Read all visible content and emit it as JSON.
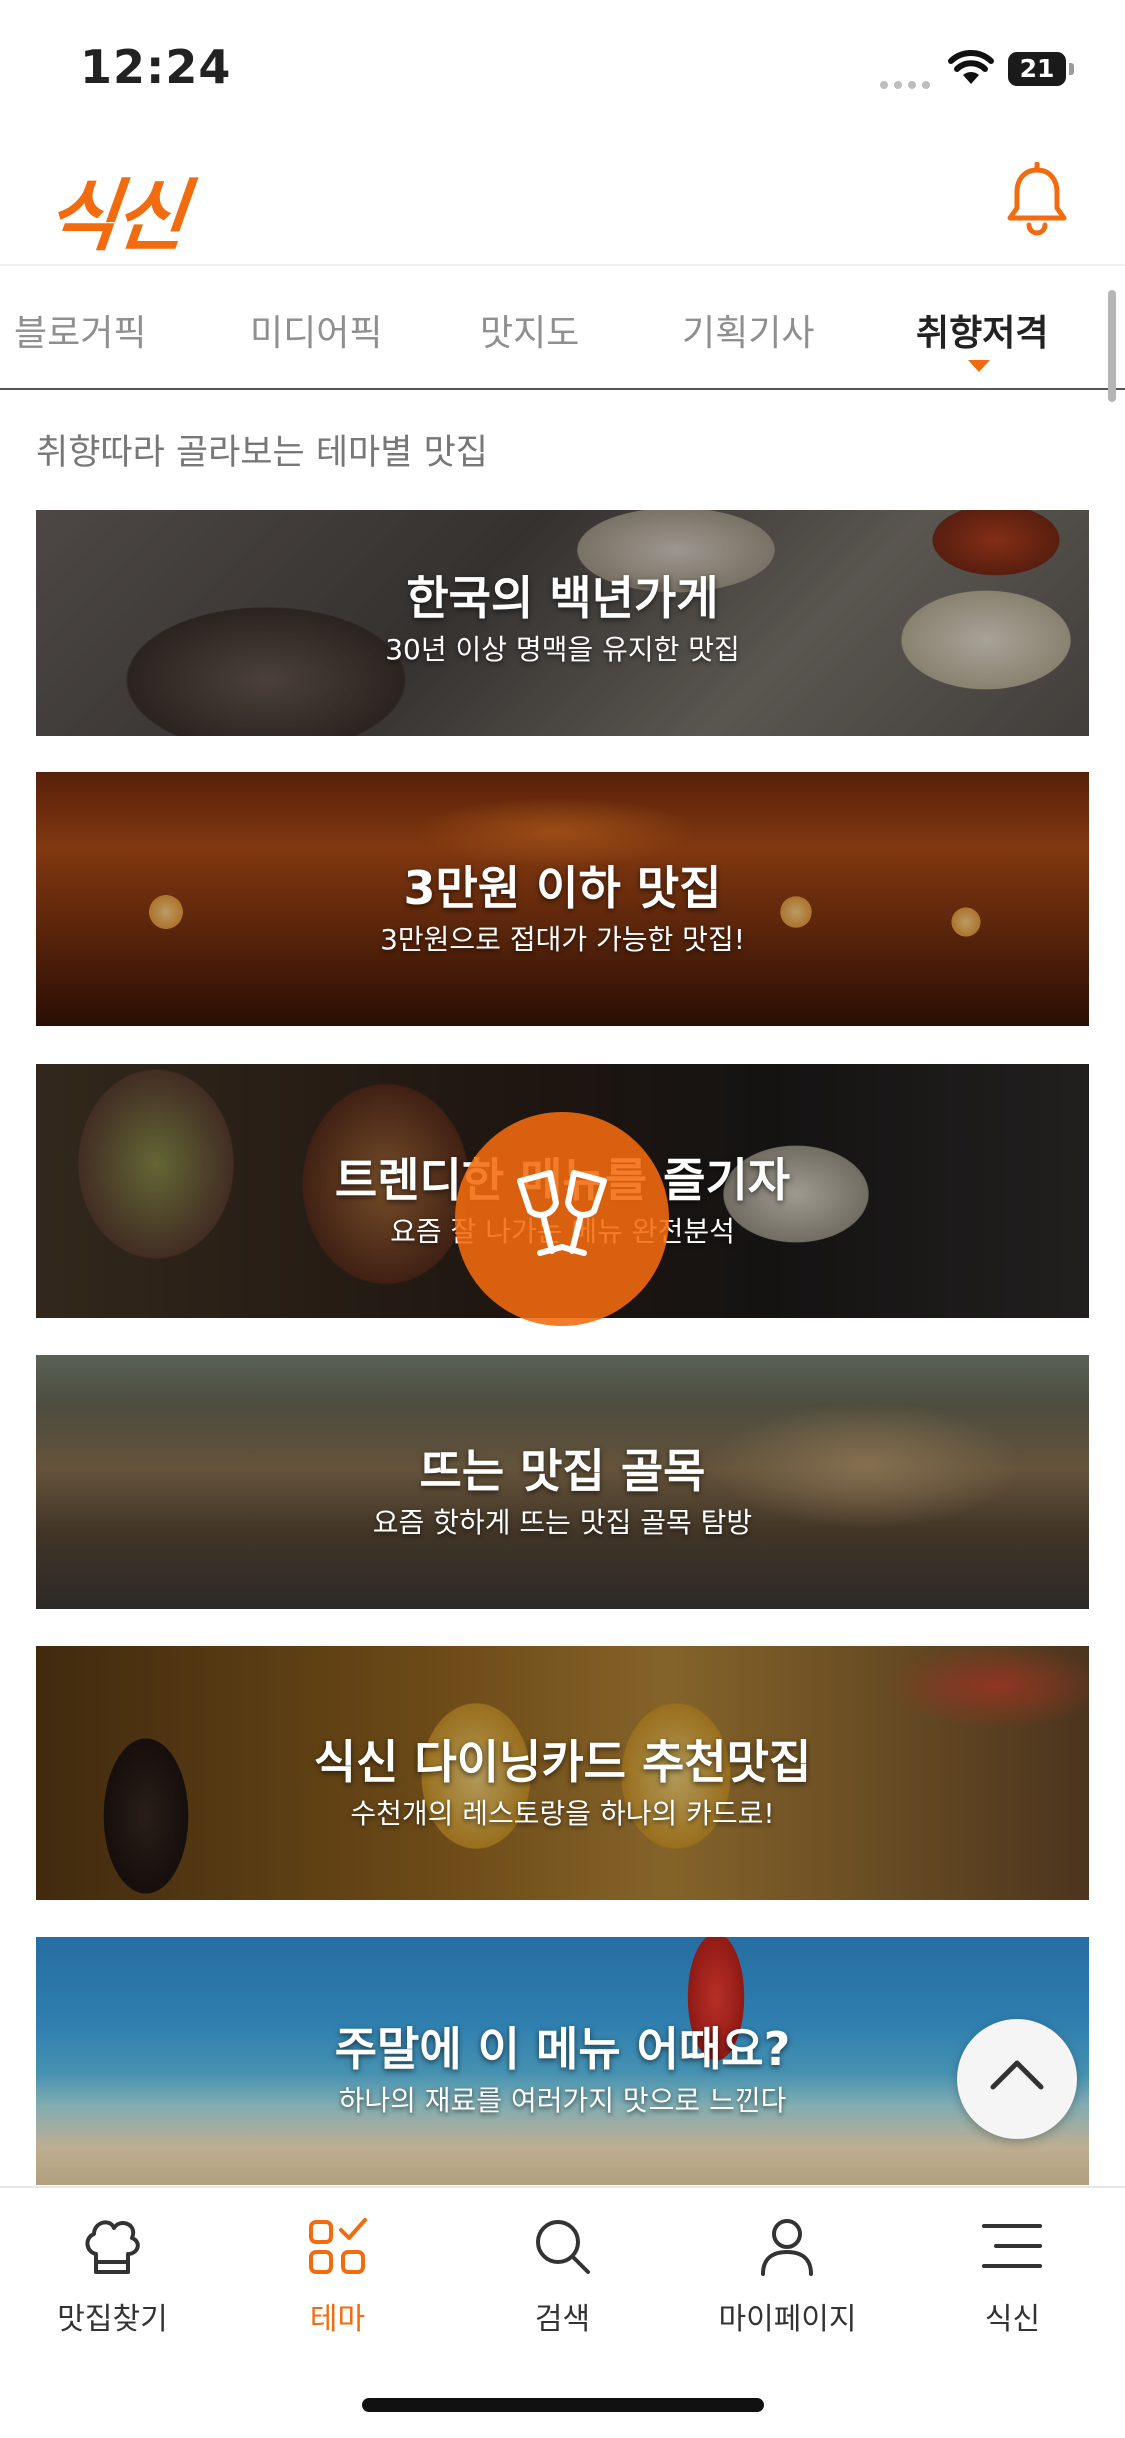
{
  "status_bar": {
    "time": "12:24",
    "battery": "21"
  },
  "header": {
    "logo": "식신",
    "bell_icon": "bell-icon"
  },
  "tabs": [
    {
      "label": "블로거픽",
      "active": false
    },
    {
      "label": "미디어픽",
      "active": false
    },
    {
      "label": "맛지도",
      "active": false
    },
    {
      "label": "기획기사",
      "active": false
    },
    {
      "label": "취향저격",
      "active": true
    }
  ],
  "section_caption": "취향따라 골라보는 테마별 맛집",
  "themes": [
    {
      "title": "한국의 백년가게",
      "subtitle": "30년 이상 명맥을 유지한 맛집"
    },
    {
      "title": "3만원 이하 맛집",
      "subtitle": "3만원으로 접대가 가능한 맛집!"
    },
    {
      "title": "트렌디한 메뉴를 즐기자",
      "subtitle": "요즘 잘 나가는 메뉴 완전분석"
    },
    {
      "title": "뜨는 맛집 골목",
      "subtitle": "요즘 핫하게 뜨는 맛집 골목 탐방"
    },
    {
      "title": "식신 다이닝카드 추천맛집",
      "subtitle": "수천개의 레스토랑을 하나의 카드로!"
    },
    {
      "title": "주말에 이 메뉴 어때요?",
      "subtitle": "하나의 재료를 여러가지 맛으로 느낀다"
    }
  ],
  "bottom_nav": [
    {
      "label": "맛집찾기",
      "icon": "chef-hat-icon",
      "active": false
    },
    {
      "label": "테마",
      "icon": "theme-grid-icon",
      "active": true
    },
    {
      "label": "검색",
      "icon": "search-icon",
      "active": false
    },
    {
      "label": "마이페이지",
      "icon": "person-icon",
      "active": false
    },
    {
      "label": "식신",
      "icon": "menu-icon",
      "active": false
    }
  ],
  "colors": {
    "accent": "#f26b0f"
  }
}
